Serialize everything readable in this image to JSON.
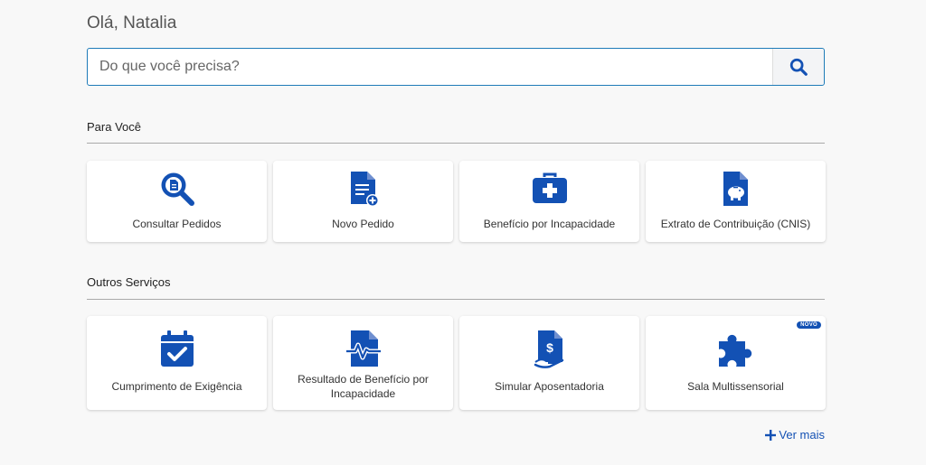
{
  "greeting": "Olá, Natalia",
  "search": {
    "placeholder": "Do que você precisa?",
    "icon": "search-icon"
  },
  "sections": {
    "para_voce": {
      "title": "Para Você",
      "cards": [
        {
          "label": "Consultar Pedidos",
          "icon": "magnifier-document-icon"
        },
        {
          "label": "Novo Pedido",
          "icon": "document-add-icon"
        },
        {
          "label": "Benefício por Incapacidade",
          "icon": "medical-kit-icon"
        },
        {
          "label": "Extrato de Contribuição (CNIS)",
          "icon": "document-piggy-bank-icon"
        }
      ]
    },
    "outros": {
      "title": "Outros Serviços",
      "cards": [
        {
          "label": "Cumprimento de Exigência",
          "icon": "calendar-check-icon"
        },
        {
          "label": "Resultado de Benefício por Incapacidade",
          "icon": "document-pulse-icon"
        },
        {
          "label": "Simular Aposentadoria",
          "icon": "document-money-hand-icon"
        },
        {
          "label": "Sala Multissensorial",
          "icon": "puzzle-piece-icon",
          "badge": "NOVO"
        }
      ]
    }
  },
  "ver_mais": "Ver mais",
  "colors": {
    "accent": "#1351b4",
    "search_border": "#1e7bb8",
    "background": "#f8f8f8"
  }
}
